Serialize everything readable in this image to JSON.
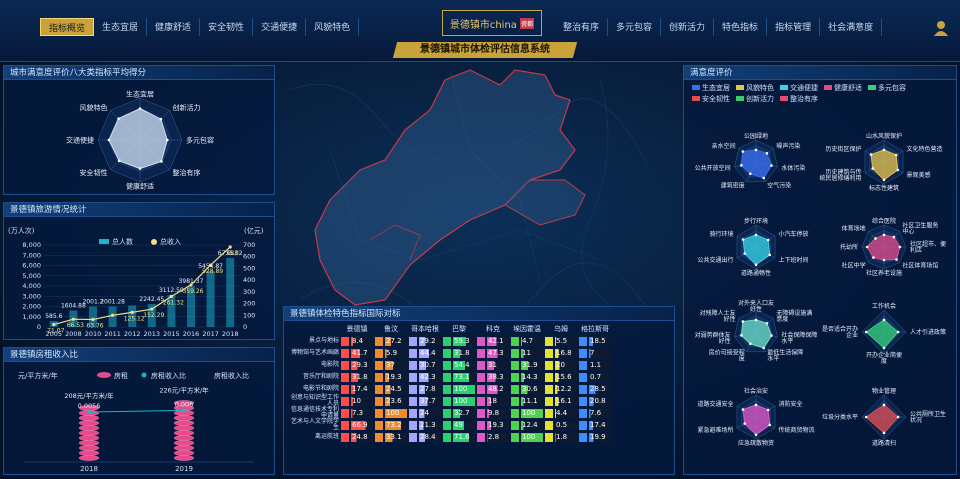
{
  "nav_left": [
    "指标概览",
    "生态宜居",
    "健康舒适",
    "安全韧性",
    "交通便捷",
    "风貌特色"
  ],
  "nav_right": [
    "整治有序",
    "多元包容",
    "创新活力",
    "特色指标",
    "指标管理",
    "社会满意度"
  ],
  "logo": "景德镇市china",
  "logo_badge": "瓷都",
  "system_title": "景德镇城市体检评估信息系统",
  "radar_panel": {
    "title": "城市满意度评价八大类指标平均得分",
    "axes": [
      "生态宜居",
      "创新活力",
      "多元包容",
      "整治有序",
      "健康舒适",
      "安全韧性",
      "交通便捷",
      "风貌特色"
    ],
    "values": [
      0.75,
      0.7,
      0.65,
      0.72,
      0.68,
      0.7,
      0.74,
      0.72
    ]
  },
  "tourism": {
    "title": "景德镇旅游情况统计",
    "left_unit": "(万人次)",
    "right_unit": "(亿元)",
    "legend": [
      "总人数",
      "总收入"
    ],
    "chart_data": {
      "type": "bar",
      "categories": [
        "2005",
        "2008",
        "2010",
        "2011",
        "2012",
        "2013",
        "2015",
        "2016",
        "2017",
        "2018"
      ],
      "series": [
        {
          "name": "总人数",
          "values": [
            585.6,
            1604.88,
            2001.2,
            2001.28,
            2100,
            2242.45,
            3112.59,
            3981.37,
            5454.87,
            6735.02
          ]
        },
        {
          "name": "总收入",
          "values": [
            21.07,
            66.53,
            63.76,
            100,
            125.12,
            152.29,
            261.32,
            359.26,
            528.89,
            683.1
          ]
        }
      ],
      "ylim": [
        0,
        8000
      ],
      "y2lim": [
        0,
        700
      ],
      "yticks": [
        "0",
        "1,000",
        "2,000",
        "3,000",
        "4,000",
        "5,000",
        "6,000",
        "7,000",
        "8,000"
      ],
      "y2ticks": [
        "0",
        "100",
        "200",
        "300",
        "400",
        "500",
        "600",
        "700"
      ],
      "labels_people": [
        "585.6",
        "1604.88",
        "2001.2",
        "2001.28",
        "",
        "2242.45",
        "3112.59",
        "3981.37",
        "5454.87",
        "6735.02"
      ],
      "labels_income": [
        "21.07",
        "66.53",
        "63.76",
        "",
        "125.12",
        "152.29",
        "261.32",
        "359.26",
        "528.89",
        "683"
      ]
    }
  },
  "rent": {
    "title": "景德镇房租收入比",
    "left_unit": "元/平方米/年",
    "right_unit": "房租收入比",
    "legend": [
      "房租",
      "房租收入比"
    ],
    "chart_data": {
      "type": "bar",
      "categories": [
        "2018",
        "2019"
      ],
      "series": [
        {
          "name": "房租",
          "values": [
            208,
            226
          ]
        },
        {
          "name": "房租收入比",
          "values": [
            0.0056,
            0.006
          ]
        }
      ],
      "labels_rent": [
        "208元/平方米/年",
        "226元/平方米/年"
      ],
      "labels_ratio": [
        "0.0056",
        "0.006"
      ]
    }
  },
  "intl": {
    "title": "景德镇体检特色指标国际对标",
    "columns": [
      "景德镇",
      "鲁汶",
      "哥本哈根",
      "巴黎",
      "科克",
      "埃因霍温",
      "乌姆",
      "格拉斯哥"
    ],
    "colors": [
      "#ff4b4b",
      "#f08a2a",
      "#a5a5ff",
      "#24d36b",
      "#e257c7",
      "#4fd34f",
      "#e6e030",
      "#3f8cff"
    ],
    "rows": [
      {
        "label": "景点与地标",
        "v": [
          "8.4",
          "27.2",
          "29.2",
          "59.3",
          "42.1",
          "4.7",
          "5.5",
          "18.5"
        ]
      },
      {
        "label": "博物馆与艺术画廊",
        "v": [
          "41.7",
          "5.9",
          "44.4",
          "31.8",
          "47.3",
          "11",
          "16.8",
          "7"
        ]
      },
      {
        "label": "电影院",
        "v": [
          "29.3",
          "37",
          "30.7",
          "54.4",
          "31",
          "31.9",
          "20",
          "1.1"
        ]
      },
      {
        "label": "音乐厅和剧院",
        "v": [
          "31.8",
          "19.3",
          "42.3",
          "73.1",
          "38.3",
          "14.3",
          "15.6",
          "0.7"
        ]
      },
      {
        "label": "电影节和剧院",
        "v": [
          "17.4",
          "24.5",
          "27.8",
          "100",
          "48.2",
          "30.6",
          "12.2",
          "28.5"
        ]
      },
      {
        "label": "创意与知识型工作人员",
        "v": [
          "10",
          "23.6",
          "37.7",
          "100",
          "18",
          "11.1",
          "16.1",
          "20.8"
        ]
      },
      {
        "label": "信息通信技术专利申请量",
        "v": [
          "7.3",
          "100",
          "24",
          "32.7",
          "9.8",
          "100",
          "4.4",
          "7.6"
        ]
      },
      {
        "label": "艺术与人文学院学生",
        "v": [
          "66.9",
          "73.2",
          "21.3",
          "49",
          "19.3",
          "12.4",
          "0.5",
          "17.4"
        ]
      },
      {
        "label": "离运航班",
        "v": [
          "24.8",
          "33.1",
          "28.4",
          "71.6",
          "2.8",
          "100",
          "1.8",
          "19.9"
        ]
      }
    ]
  },
  "satisfaction": {
    "title": "满意度评价",
    "legend": [
      "生态宜居",
      "风貌特色",
      "交通便捷",
      "健康舒适",
      "多元包容",
      "安全韧性",
      "创新活力",
      "整治有序"
    ],
    "legend_colors": [
      "#3a6ff0",
      "#e8c34a",
      "#36d6e6",
      "#e24a8a",
      "#34d07a",
      "#e24d4d",
      "#3ec96a",
      "#e24d70"
    ],
    "radars": [
      {
        "color": "#3a6ff0",
        "axes": [
          "公园绿地",
          "噪声污染",
          "水体污染",
          "空气污染",
          "建筑密度",
          "公共开放空间",
          "亲水空间"
        ]
      },
      {
        "color": "#e8c34a",
        "axes": [
          "山水风貌保护",
          "文化特色营造",
          "景观美感",
          "标志性建筑",
          "历史建筑与传统民居修缮利用",
          "历史街区保护"
        ]
      },
      {
        "color": "#36d6e6",
        "axes": [
          "步行环境",
          "小汽车停放",
          "上下班时间",
          "道路通畅性",
          "公共交通出行",
          "骑行环境"
        ]
      },
      {
        "color": "#e24a8a",
        "axes": [
          "综合医院",
          "社区卫生服务中心",
          "社区超市、便利店",
          "社区体育场馆",
          "社区养老设施",
          "社区中学",
          "托幼所",
          "体育场地"
        ]
      },
      {
        "color": "#6fe0c8",
        "axes": [
          "对外来人口友好性",
          "无障碍设施满意度",
          "社会保障保障水平",
          "最低生活保障水平",
          "房价可接受程度",
          "对弱势群体友好性",
          "对残障人士友好性"
        ]
      },
      {
        "color": "#34d07a",
        "axes": [
          "工作机会",
          "人才引进政策",
          "开办企业简便度",
          "是否适合开办企业"
        ]
      },
      {
        "color": "#e257c7",
        "axes": [
          "社会治安",
          "消防安全",
          "传统商贸物流",
          "应急疏散物资",
          "紧急避难场所",
          "道路交通安全"
        ]
      },
      {
        "color": "#e24d4d",
        "axes": [
          "物业管理",
          "公共厕所卫生状况",
          "道路清扫",
          "垃圾分类水平"
        ]
      }
    ]
  }
}
